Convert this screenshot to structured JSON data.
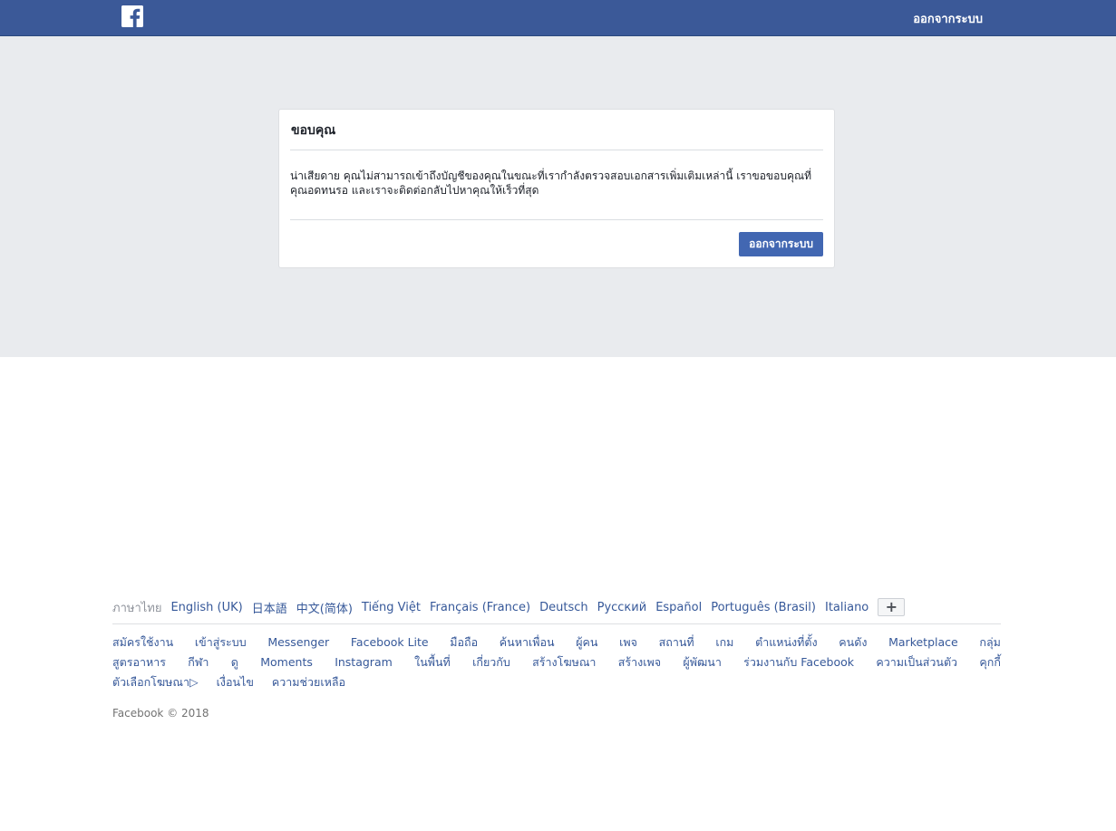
{
  "header": {
    "logo_icon": "facebook-f-icon",
    "logout_label": "ออกจากระบบ",
    "bar_color": "#3b5998"
  },
  "dialog": {
    "title": "ขอบคุณ",
    "message": "น่าเสียดาย คุณไม่สามารถเข้าถึงบัญชีของคุณในขณะที่เรากำลังตรวจสอบเอกสารเพิ่มเติมเหล่านี้ เราขอขอบคุณที่คุณอดทนรอ และเราจะติดต่อกลับไปหาคุณให้เร็วที่สุด",
    "button_label": "ออกจากระบบ",
    "button_color": "#4267b2"
  },
  "footer": {
    "languages": [
      "ภาษาไทย",
      "English (UK)",
      "日本語",
      "中文(简体)",
      "Tiếng Việt",
      "Français (France)",
      "Deutsch",
      "Русский",
      "Español",
      "Português (Brasil)",
      "Italiano"
    ],
    "more_languages_label": "+",
    "links_row1": [
      "สมัครใช้งาน",
      "เข้าสู่ระบบ",
      "Messenger",
      "Facebook Lite",
      "มือถือ",
      "ค้นหาเพื่อน",
      "ผู้คน",
      "เพจ",
      "สถานที่",
      "เกม",
      "ตำแหน่งที่ตั้ง",
      "คนดัง",
      "Marketplace",
      "กลุ่ม"
    ],
    "links_row2": [
      "สูตรอาหาร",
      "กีฬา",
      "ดู",
      "Moments",
      "Instagram",
      "ในพื้นที่",
      "เกี่ยวกับ",
      "สร้างโฆษณา",
      "สร้างเพจ",
      "ผู้พัฒนา",
      "ร่วมงานกับ Facebook",
      "ความเป็นส่วนตัว",
      "คุกกี้"
    ],
    "links_row3": [
      "ตัวเลือกโฆษณา▷",
      "เงื่อนไข",
      "ความช่วยเหลือ"
    ],
    "copyright": "Facebook © 2018"
  }
}
